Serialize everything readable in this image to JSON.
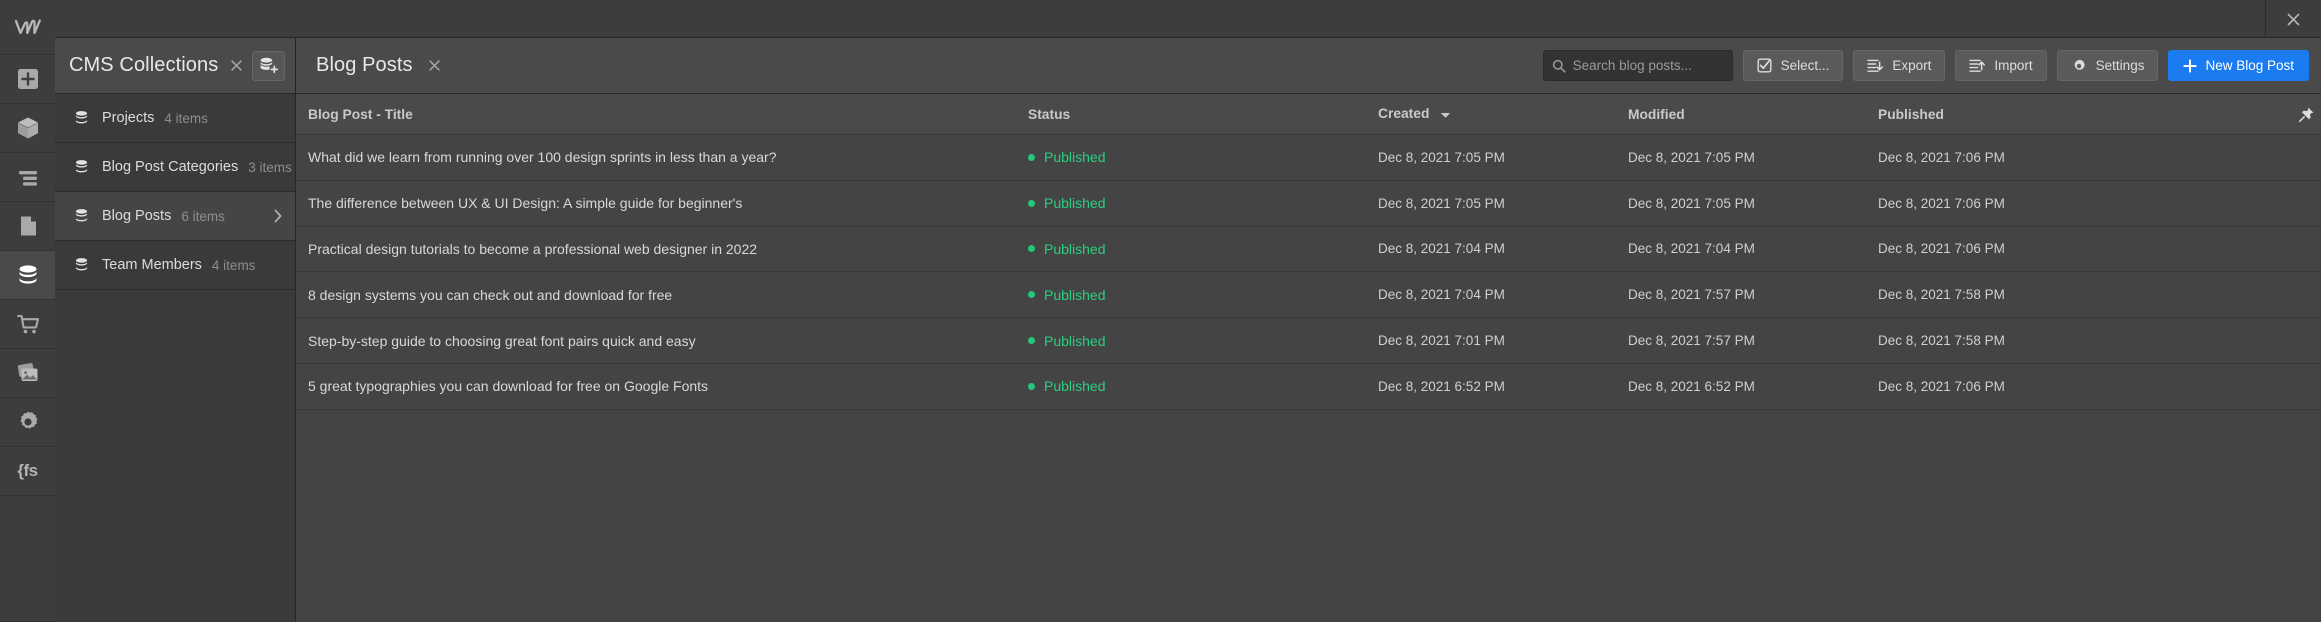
{
  "window": {
    "close_label": "×",
    "close_icon": "close-icon"
  },
  "rail": {
    "logo_icon": "webflow-logo-icon",
    "items": [
      {
        "icon": "add-element-icon",
        "name": "add-panel",
        "active": false
      },
      {
        "icon": "components-box-icon",
        "name": "components-panel",
        "active": false
      },
      {
        "icon": "navigator-icon",
        "name": "navigator-panel",
        "active": false
      },
      {
        "icon": "pages-icon",
        "name": "pages-panel",
        "active": false
      },
      {
        "icon": "cms-database-icon",
        "name": "cms-panel",
        "active": true
      },
      {
        "icon": "ecommerce-cart-icon",
        "name": "ecommerce-panel",
        "active": false
      },
      {
        "icon": "assets-images-icon",
        "name": "assets-panel",
        "active": false
      },
      {
        "icon": "gear-icon",
        "name": "settings-panel",
        "active": false
      },
      {
        "icon": "fs-braces-icon",
        "name": "fs-panel",
        "active": false,
        "text": "{fs"
      }
    ],
    "fs_label": "{fs"
  },
  "collections": {
    "title": "CMS Collections",
    "close_label": "×",
    "new_collection_icon": "new-collection-icon",
    "items": [
      {
        "label": "Projects",
        "count": "4 items",
        "active": false,
        "chevron": false
      },
      {
        "label": "Blog Post Categories",
        "count": "3 items",
        "active": false,
        "chevron": false
      },
      {
        "label": "Blog Posts",
        "count": "6 items",
        "active": true,
        "chevron": true
      },
      {
        "label": "Team Members",
        "count": "4 items",
        "active": false,
        "chevron": false
      }
    ]
  },
  "main": {
    "title": "Blog Posts",
    "close_label": "×",
    "search": {
      "placeholder": "Search blog posts...",
      "value": "",
      "icon": "search-icon"
    },
    "buttons": [
      {
        "label": "Select...",
        "icon": "checkbox-icon",
        "name": "select-button",
        "primary": false
      },
      {
        "label": "Export",
        "icon": "export-down-icon",
        "name": "export-button",
        "primary": false
      },
      {
        "label": "Import",
        "icon": "import-up-icon",
        "name": "import-button",
        "primary": false
      },
      {
        "label": "Settings",
        "icon": "gear-icon",
        "name": "settings-button",
        "primary": false
      },
      {
        "label": "New Blog Post",
        "icon": "plus-icon",
        "name": "new-blog-post-button",
        "primary": true
      }
    ]
  },
  "table": {
    "columns": [
      {
        "label": "Blog Post - Title",
        "key": "title"
      },
      {
        "label": "Status",
        "key": "status"
      },
      {
        "label": "Created",
        "key": "created",
        "sorted": true,
        "sort_icon": "chevron-down-icon"
      },
      {
        "label": "Modified",
        "key": "modified"
      },
      {
        "label": "Published",
        "key": "published"
      }
    ],
    "pin_icon": "pin-icon",
    "rows": [
      {
        "title": "What did we learn from running over 100 design sprints in less than a year?",
        "status": "Published",
        "created": "Dec 8, 2021 7:05 PM",
        "modified": "Dec 8, 2021 7:05 PM",
        "published": "Dec 8, 2021 7:06 PM"
      },
      {
        "title": "The difference between UX & UI Design: A simple guide for beginner's",
        "status": "Published",
        "created": "Dec 8, 2021 7:05 PM",
        "modified": "Dec 8, 2021 7:05 PM",
        "published": "Dec 8, 2021 7:06 PM"
      },
      {
        "title": "Practical design tutorials to become a professional web designer in 2022",
        "status": "Published",
        "created": "Dec 8, 2021 7:04 PM",
        "modified": "Dec 8, 2021 7:04 PM",
        "published": "Dec 8, 2021 7:06 PM"
      },
      {
        "title": "8 design systems you can check out and download for free",
        "status": "Published",
        "created": "Dec 8, 2021 7:04 PM",
        "modified": "Dec 8, 2021 7:57 PM",
        "published": "Dec 8, 2021 7:58 PM"
      },
      {
        "title": "Step-by-step guide to choosing great font pairs quick and easy",
        "status": "Published",
        "created": "Dec 8, 2021 7:01 PM",
        "modified": "Dec 8, 2021 7:57 PM",
        "published": "Dec 8, 2021 7:58 PM"
      },
      {
        "title": "5 great typographies you can download for free on Google Fonts",
        "status": "Published",
        "created": "Dec 8, 2021 6:52 PM",
        "modified": "Dec 8, 2021 6:52 PM",
        "published": "Dec 8, 2021 7:06 PM"
      }
    ]
  },
  "colors": {
    "accent_blue": "#1a7cf0",
    "status_green": "#28cf80",
    "panel_bg": "#3a3a3a",
    "main_bg": "#444444",
    "header_bg": "#4a4a4a"
  }
}
